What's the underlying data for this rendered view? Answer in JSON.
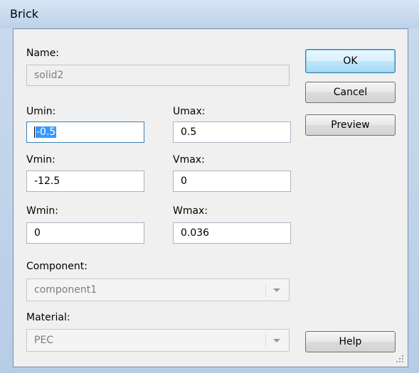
{
  "window": {
    "title": "Brick"
  },
  "form": {
    "name_label": "Name:",
    "name_value": "solid2",
    "umin_label": "Umin:",
    "umin_value": "-0.5",
    "umax_label": "Umax:",
    "umax_value": "0.5",
    "vmin_label": "Vmin:",
    "vmin_value": "-12.5",
    "vmax_label": "Vmax:",
    "vmax_value": "0",
    "wmin_label": "Wmin:",
    "wmin_value": "0",
    "wmax_label": "Wmax:",
    "wmax_value": "0.036",
    "component_label": "Component:",
    "component_value": "component1",
    "material_label": "Material:",
    "material_value": "PEC"
  },
  "buttons": {
    "ok": "OK",
    "cancel": "Cancel",
    "preview": "Preview",
    "help": "Help"
  },
  "icons": {
    "combo_arrow": "chevron-down-icon",
    "resize": "resize-grip-icon"
  },
  "colors": {
    "default_button_border": "#3c7fb1",
    "selection": "#3399ff"
  }
}
